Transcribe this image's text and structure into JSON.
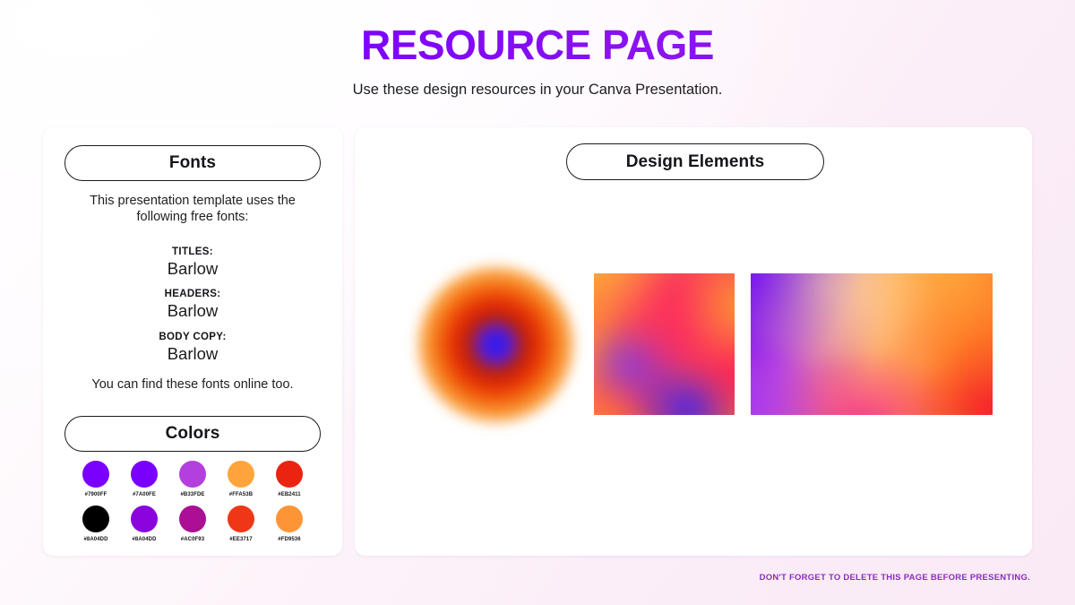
{
  "header": {
    "title": "RESOURCE PAGE",
    "subtitle": "Use these design resources in your Canva Presentation."
  },
  "fonts_panel": {
    "pill_label": "Fonts",
    "intro": "This presentation template uses the following free fonts:",
    "outro": "You can find these fonts online too.",
    "entries": [
      {
        "role": "TITLES:",
        "font": "Barlow"
      },
      {
        "role": "HEADERS:",
        "font": "Barlow"
      },
      {
        "role": "BODY COPY:",
        "font": "Barlow"
      }
    ]
  },
  "colors_panel": {
    "pill_label": "Colors",
    "rows": [
      [
        {
          "hex_label": "#7900FF",
          "color": "#7900ff"
        },
        {
          "hex_label": "#7A00FE",
          "color": "#7a00fe"
        },
        {
          "hex_label": "#B33FDE",
          "color": "#b33fde"
        },
        {
          "hex_label": "#FFA53B",
          "color": "#ffa53b"
        },
        {
          "hex_label": "#EB2411",
          "color": "#eb2411"
        }
      ],
      [
        {
          "hex_label": "#8A04DD",
          "color": "#000000"
        },
        {
          "hex_label": "#8A04DD",
          "color": "#8a04dd"
        },
        {
          "hex_label": "#AC0F93",
          "color": "#ac0f93"
        },
        {
          "hex_label": "#EE3717",
          "color": "#ee3717"
        },
        {
          "hex_label": "#FD9536",
          "color": "#fd9536"
        }
      ]
    ]
  },
  "elements_panel": {
    "pill_label": "Design Elements",
    "items": [
      {
        "name": "radial-blur-gradient-circle"
      },
      {
        "name": "mesh-gradient-square"
      },
      {
        "name": "mesh-gradient-wide"
      }
    ]
  },
  "footer": {
    "note": "DON'T FORGET TO DELETE THIS PAGE BEFORE PRESENTING."
  }
}
